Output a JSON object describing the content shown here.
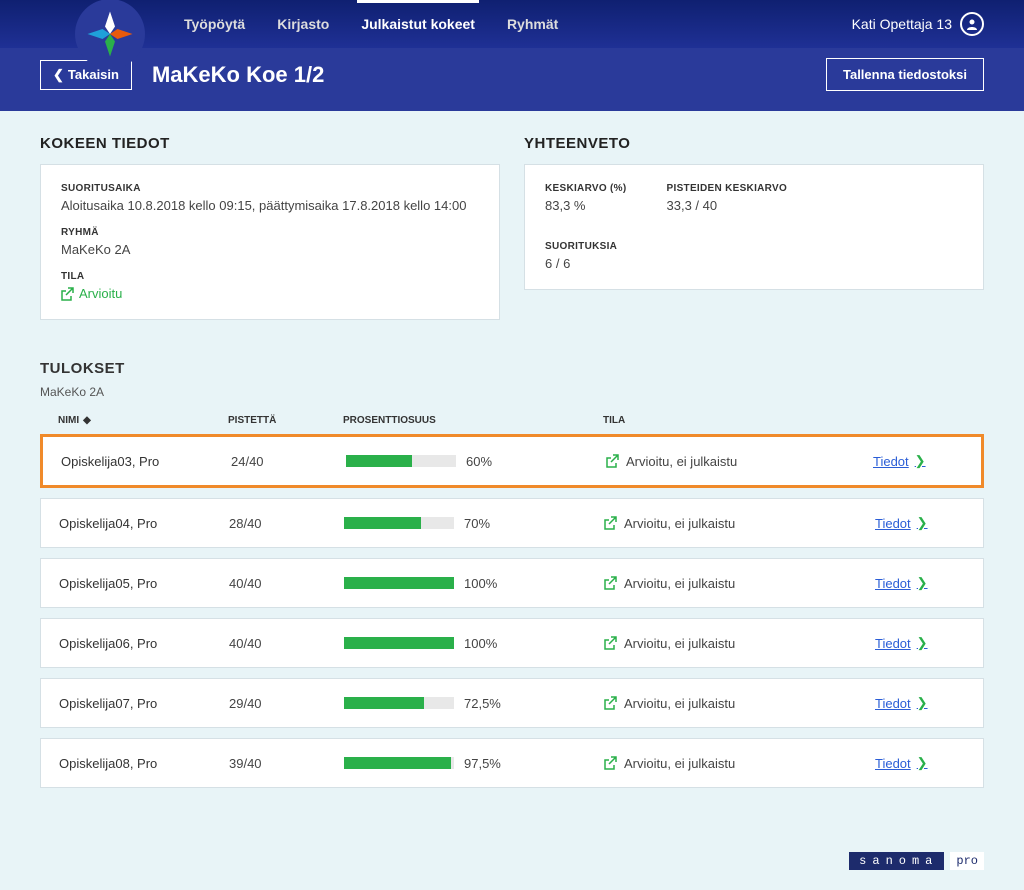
{
  "nav": {
    "tyopoyta": "Työpöytä",
    "kirjasto": "Kirjasto",
    "julkaistut": "Julkaistut kokeet",
    "ryhmat": "Ryhmät"
  },
  "user": {
    "name": "Kati Opettaja 13"
  },
  "subheader": {
    "back": "Takaisin",
    "title": "MaKeKo Koe 1/2",
    "save": "Tallenna tiedostoksi"
  },
  "details": {
    "heading": "KOKEEN TIEDOT",
    "time_label": "SUORITUSAIKA",
    "time_value": "Aloitusaika 10.8.2018 kello 09:15, päättymisaika 17.8.2018 kello 14:00",
    "group_label": "RYHMÄ",
    "group_value": "MaKeKo 2A",
    "state_label": "TILA",
    "state_value": "Arvioitu"
  },
  "summary": {
    "heading": "YHTEENVETO",
    "avg_label": "KESKIARVO (%)",
    "avg_value": "83,3 %",
    "points_label": "PISTEIDEN KESKIARVO",
    "points_value": "33,3 / 40",
    "count_label": "SUORITUKSIA",
    "count_value": "6 / 6"
  },
  "results": {
    "heading": "TULOKSET",
    "group": "MaKeKo 2A",
    "col_name": "NIMI",
    "col_points": "PISTETTÄ",
    "col_pct": "PROSENTTIOSUUS",
    "col_state": "TILA",
    "status_text": "Arvioitu, ei julkaistu",
    "action": "Tiedot",
    "rows": [
      {
        "name": "Opiskelija03, Pro",
        "points": "24/40",
        "pct": "60%",
        "pct_num": 60
      },
      {
        "name": "Opiskelija04, Pro",
        "points": "28/40",
        "pct": "70%",
        "pct_num": 70
      },
      {
        "name": "Opiskelija05, Pro",
        "points": "40/40",
        "pct": "100%",
        "pct_num": 100
      },
      {
        "name": "Opiskelija06, Pro",
        "points": "40/40",
        "pct": "100%",
        "pct_num": 100
      },
      {
        "name": "Opiskelija07, Pro",
        "points": "29/40",
        "pct": "72,5%",
        "pct_num": 72.5
      },
      {
        "name": "Opiskelija08, Pro",
        "points": "39/40",
        "pct": "97,5%",
        "pct_num": 97.5
      }
    ]
  },
  "brand": {
    "name": "sanoma",
    "suffix": "pro"
  }
}
